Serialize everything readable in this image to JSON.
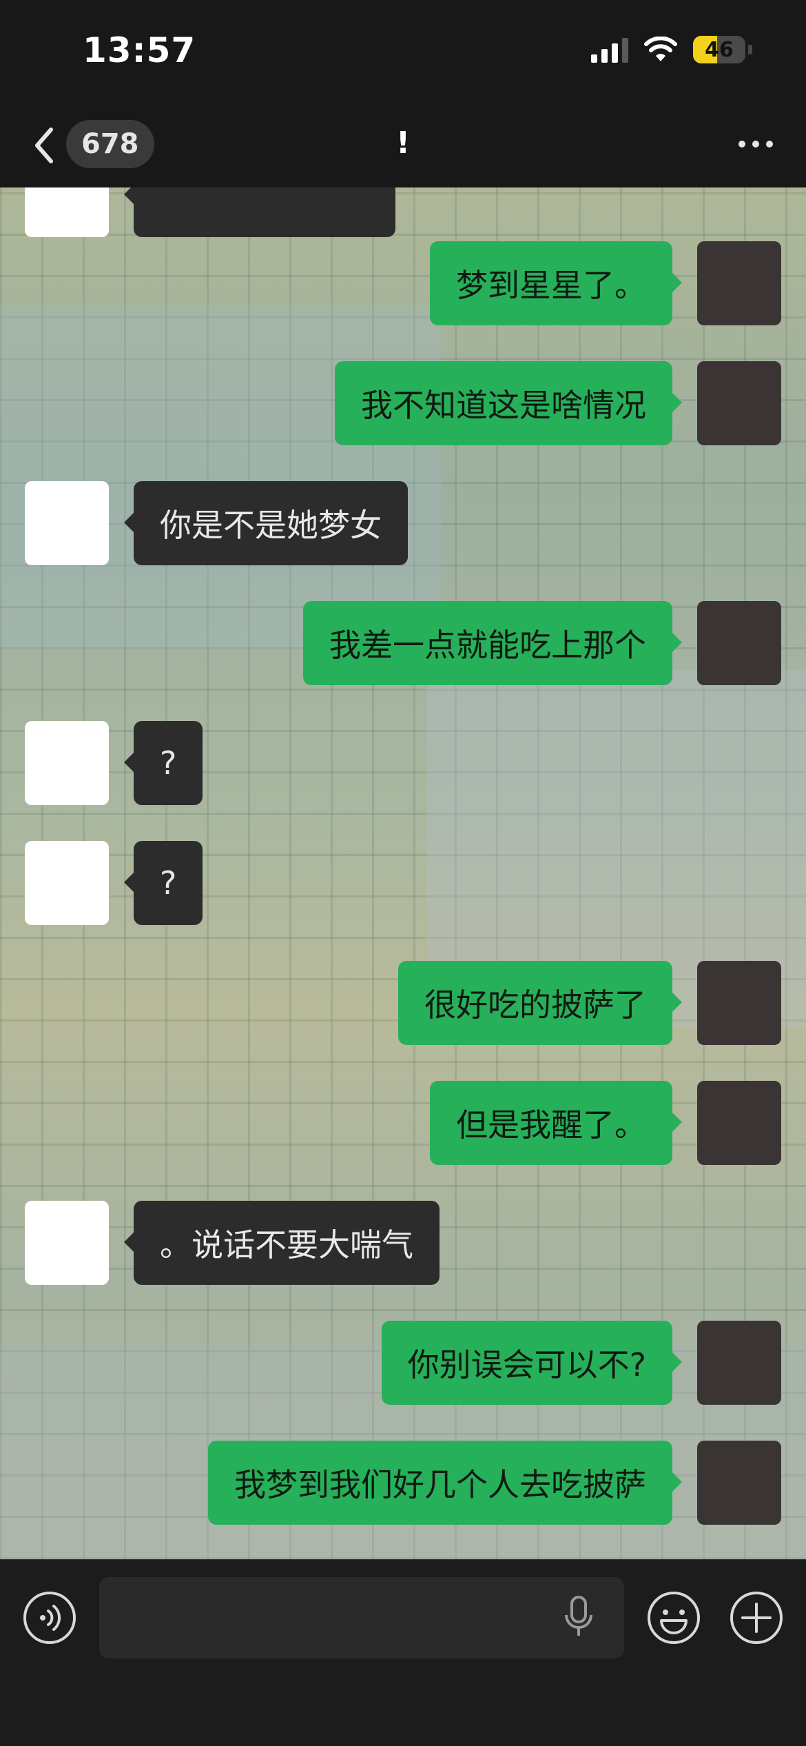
{
  "status_bar": {
    "time": "13:57",
    "battery_level": "46",
    "icons": [
      "signal-icon",
      "wifi-icon",
      "battery-icon"
    ]
  },
  "nav": {
    "unread_count": "678",
    "title": "!",
    "back_icon": "chevron-left-icon",
    "more_icon": "more-dots-icon"
  },
  "messages": [
    {
      "side": "right",
      "text": "梦到星星了。"
    },
    {
      "side": "right",
      "text": "我不知道这是啥情况"
    },
    {
      "side": "left",
      "text": "你是不是她梦女"
    },
    {
      "side": "right",
      "text": "我差一点就能吃上那个"
    },
    {
      "side": "left",
      "text": "?"
    },
    {
      "side": "left",
      "text": "?"
    },
    {
      "side": "right",
      "text": "很好吃的披萨了"
    },
    {
      "side": "right",
      "text": "但是我醒了。"
    },
    {
      "side": "left",
      "text": "。说话不要大喘气"
    },
    {
      "side": "right",
      "text": "你别误会可以不?"
    },
    {
      "side": "right",
      "text": "我梦到我们好几个人去吃披萨"
    }
  ],
  "input_bar": {
    "icons": [
      "voice-icon",
      "microphone-icon",
      "emoji-icon",
      "plus-icon"
    ]
  },
  "colors": {
    "sent_bubble": "#27b05a",
    "received_bubble": "#2c2c2c",
    "bar_bg": "#181818"
  }
}
